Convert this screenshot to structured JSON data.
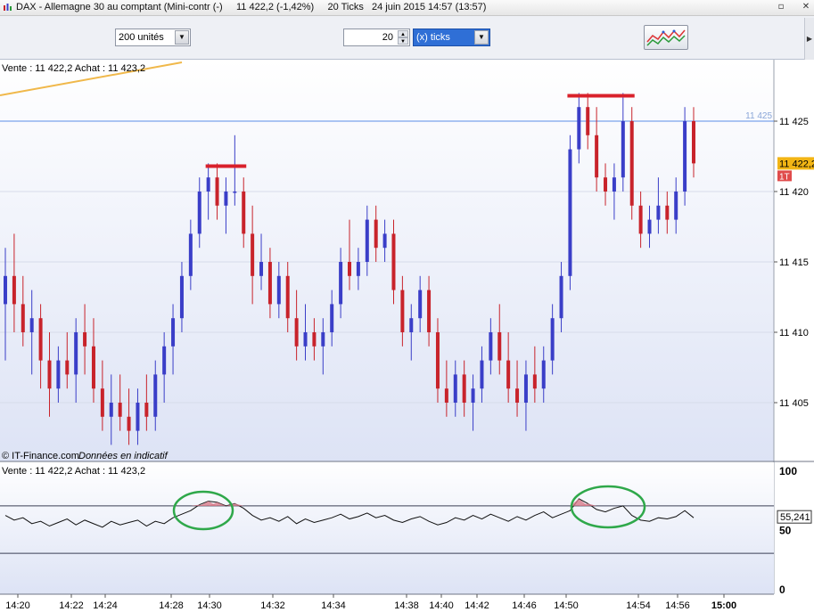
{
  "window": {
    "title": "DAX - Allemagne 30 au comptant (Mini-contr (-)     11 422,2 (-1,42%)     20 Ticks   24 juin 2015 14:57 (13:57)"
  },
  "toolbar": {
    "units_select": "200 unités",
    "tick_count": "20",
    "tick_mode_select": "(x) ticks"
  },
  "price_panel": {
    "header": "Vente : 11 422,2 Achat : 11 423,2",
    "credit": "© IT-Finance.com",
    "disclaimer": "Données en indicatif",
    "y_labels": [
      "11 425",
      "11 420",
      "11 415",
      "11 410",
      "11 405"
    ],
    "ref_line_label": "11 425",
    "last_price_badge": "11 422,2",
    "timeframe_badge": "1T",
    "colors": {
      "up": "#3a3ec8",
      "down": "#c8232b",
      "ref_line": "#5a8de6",
      "trend": "#f0b84a",
      "badge": "#f2b515",
      "marker": "#d9212b"
    }
  },
  "indicator_panel": {
    "header": "Vente : 11 422,2 Achat : 11 423,2",
    "y_labels": [
      "100",
      "50",
      "0"
    ],
    "value_badge": "55,241",
    "circle_color": "#2fa84a"
  },
  "x_axis": {
    "labels": [
      "14:20",
      "14:22",
      "14:24",
      "14:28",
      "14:30",
      "14:32",
      "14:34",
      "14:38",
      "14:40",
      "14:42",
      "14:46",
      "14:50",
      "14:54",
      "14:56",
      "15:00"
    ]
  },
  "chart_data": {
    "type": "candlestick",
    "ohlc": [
      [
        11412,
        11416,
        11408,
        11414
      ],
      [
        11414,
        11417,
        11410,
        11412
      ],
      [
        11412,
        11414,
        11409,
        11410
      ],
      [
        11410,
        11413,
        11407,
        11411
      ],
      [
        11411,
        11412,
        11406,
        11408
      ],
      [
        11408,
        11410,
        11404,
        11406
      ],
      [
        11406,
        11409,
        11405,
        11408
      ],
      [
        11408,
        11410,
        11406,
        11407
      ],
      [
        11407,
        11411,
        11405,
        11410
      ],
      [
        11410,
        11412,
        11407,
        11409
      ],
      [
        11409,
        11411,
        11405,
        11406
      ],
      [
        11406,
        11408,
        11403,
        11404
      ],
      [
        11404,
        11407,
        11402,
        11405
      ],
      [
        11405,
        11407,
        11403,
        11404
      ],
      [
        11404,
        11406,
        11402,
        11403
      ],
      [
        11403,
        11406,
        11402,
        11405
      ],
      [
        11405,
        11407,
        11403,
        11404
      ],
      [
        11404,
        11408,
        11403,
        11407
      ],
      [
        11407,
        11410,
        11405,
        11409
      ],
      [
        11409,
        11412,
        11407,
        11411
      ],
      [
        11411,
        11415,
        11410,
        11414
      ],
      [
        11414,
        11418,
        11413,
        11417
      ],
      [
        11417,
        11421,
        11416,
        11420
      ],
      [
        11420,
        11422,
        11418,
        11421
      ],
      [
        11421,
        11422,
        11418,
        11419
      ],
      [
        11419,
        11421,
        11417,
        11420
      ],
      [
        11420,
        11424,
        11419,
        11420
      ],
      [
        11420,
        11421,
        11416,
        11417
      ],
      [
        11417,
        11419,
        11412,
        11414
      ],
      [
        11414,
        11417,
        11413,
        11415
      ],
      [
        11415,
        11416,
        11411,
        11412
      ],
      [
        11412,
        11415,
        11411,
        11414
      ],
      [
        11414,
        11415,
        11410,
        11411
      ],
      [
        11411,
        11413,
        11408,
        11409
      ],
      [
        11409,
        11412,
        11408,
        11410
      ],
      [
        11410,
        11411,
        11408,
        11409
      ],
      [
        11409,
        11411,
        11407,
        11410
      ],
      [
        11410,
        11413,
        11409,
        11412
      ],
      [
        11412,
        11416,
        11411,
        11415
      ],
      [
        11415,
        11418,
        11413,
        11414
      ],
      [
        11414,
        11416,
        11413,
        11415
      ],
      [
        11415,
        11419,
        11414,
        11418
      ],
      [
        11418,
        11419,
        11415,
        11416
      ],
      [
        11416,
        11418,
        11415,
        11417
      ],
      [
        11417,
        11418,
        11412,
        11413
      ],
      [
        11413,
        11414,
        11409,
        11410
      ],
      [
        11410,
        11412,
        11408,
        11411
      ],
      [
        11411,
        11414,
        11410,
        11413
      ],
      [
        11413,
        11414,
        11409,
        11410
      ],
      [
        11410,
        11411,
        11405,
        11406
      ],
      [
        11406,
        11408,
        11404,
        11405
      ],
      [
        11405,
        11408,
        11404,
        11407
      ],
      [
        11407,
        11408,
        11404,
        11405
      ],
      [
        11405,
        11407,
        11403,
        11406
      ],
      [
        11406,
        11409,
        11405,
        11408
      ],
      [
        11408,
        11411,
        11407,
        11410
      ],
      [
        11410,
        11412,
        11407,
        11408
      ],
      [
        11408,
        11410,
        11405,
        11406
      ],
      [
        11406,
        11408,
        11404,
        11405
      ],
      [
        11405,
        11408,
        11403,
        11407
      ],
      [
        11407,
        11409,
        11405,
        11406
      ],
      [
        11406,
        11409,
        11405,
        11408
      ],
      [
        11408,
        11412,
        11407,
        11411
      ],
      [
        11411,
        11415,
        11410,
        11414
      ],
      [
        11414,
        11424,
        11413,
        11423
      ],
      [
        11423,
        11427,
        11422,
        11426
      ],
      [
        11426,
        11427,
        11423,
        11424
      ],
      [
        11424,
        11426,
        11420,
        11421
      ],
      [
        11421,
        11422,
        11419,
        11420
      ],
      [
        11420,
        11422,
        11418,
        11421
      ],
      [
        11421,
        11427,
        11420,
        11425
      ],
      [
        11425,
        11426,
        11418,
        11419
      ],
      [
        11419,
        11420,
        11416,
        11417
      ],
      [
        11417,
        11419,
        11416,
        11418
      ],
      [
        11418,
        11421,
        11417,
        11419
      ],
      [
        11419,
        11420,
        11417,
        11418
      ],
      [
        11418,
        11421,
        11417,
        11420
      ],
      [
        11420,
        11426,
        11419,
        11425
      ],
      [
        11425,
        11426,
        11421,
        11422
      ]
    ],
    "price_range": [
      11402,
      11428
    ],
    "indicator_values": [
      62,
      58,
      60,
      55,
      57,
      53,
      56,
      59,
      54,
      58,
      55,
      52,
      57,
      54,
      56,
      58,
      53,
      57,
      55,
      60,
      63,
      66,
      71,
      74,
      73,
      70,
      72,
      68,
      62,
      58,
      60,
      57,
      61,
      55,
      59,
      56,
      58,
      60,
      63,
      59,
      61,
      64,
      60,
      62,
      58,
      56,
      59,
      61,
      57,
      54,
      56,
      60,
      58,
      62,
      59,
      63,
      60,
      57,
      61,
      58,
      62,
      65,
      60,
      63,
      66,
      76,
      72,
      67,
      65,
      68,
      70,
      62,
      58,
      57,
      60,
      59,
      61,
      66,
      60
    ],
    "indicator_range": [
      0,
      100
    ],
    "indicator_levels": [
      30,
      70
    ]
  }
}
